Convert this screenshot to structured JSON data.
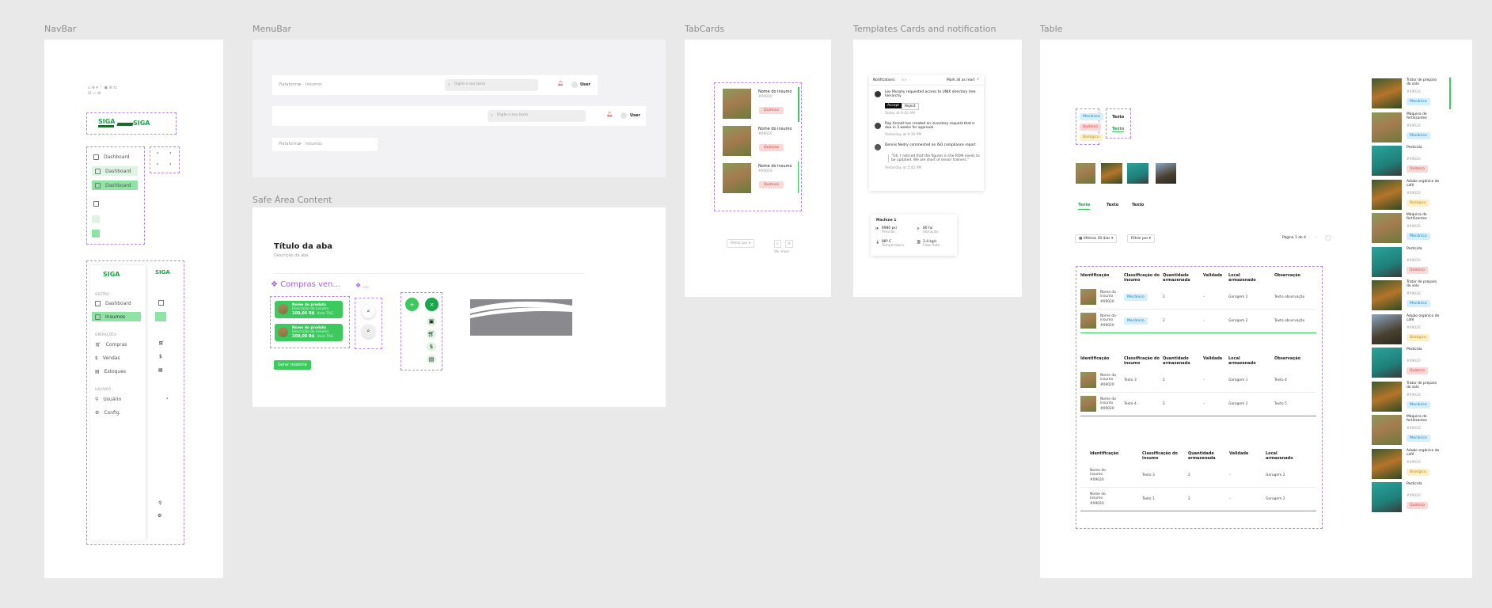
{
  "frames": {
    "navbar": "NavBar",
    "menubar": "MenuBar",
    "tabcards": "TabCards",
    "templates": "Templates Cards and notification",
    "table": "Table",
    "safe_area": "Safe Área Content"
  },
  "navbar": {
    "logo": "SIGA",
    "items": [
      "Dashboard",
      "Dashboard",
      "Dashboard"
    ],
    "sections": {
      "gestao": "GESTÃO",
      "operacoes": "OPERAÇÕES",
      "usuario": "USUÁRIO"
    },
    "menu": {
      "dashboard": "Dashboard",
      "insumos": "Insumos",
      "compras": "Compras",
      "vendas": "Vendas",
      "estoques": "Estoques",
      "usuario": "Usuário",
      "config": "Config."
    }
  },
  "menubar": {
    "breadcrumb_root": "Plataforma",
    "breadcrumb_sep": ">",
    "breadcrumb_current": "Insumos",
    "search_placeholder": "Digite o seu texto",
    "user": "User"
  },
  "safe_area": {
    "title": "Título da aba",
    "description": "Descrição da aba",
    "section_title": "Compras ven...",
    "section_title_2": "...",
    "product_name": "Nome do produto",
    "product_sub": "Descrição do insumo",
    "product_price": "200,00 R$",
    "product_tag": "Item TAG",
    "action_button": "Gerar relatório"
  },
  "tabcards": {
    "cards": [
      {
        "name": "Nome do insumo",
        "code": "#09020",
        "tag": "Químico"
      },
      {
        "name": "Nome do insumo",
        "code": "#09020",
        "tag": "Químico"
      },
      {
        "name": "Nome do insumo",
        "code": "#09020",
        "tag": "Químico"
      }
    ],
    "filter": "Filtrar por",
    "footer": "Ver mais"
  },
  "notifications": {
    "title": "Notifications",
    "mark_all": "Mark all as read",
    "items": [
      {
        "text": "Lex Murphy requested access to UNIX directory tree hierarchy",
        "time": "Today at 9:42 AM",
        "accept": "Accept",
        "reject": "Reject"
      },
      {
        "text": "Ray Arnold has created an inventory request that is due in 3 weeks for approval",
        "time": "Yesterday at 9:30 PM"
      },
      {
        "text": "Dennis Nedry commented on ISO compliance report",
        "quote": "“Oh, I noticed that the figures in the ROM needs to be updated. We are short of senior trainers.”",
        "time": "Yesterday at 5:42 PM"
      }
    ],
    "machine": {
      "title": "Machine 1",
      "stats": [
        {
          "value": "6980 psi",
          "label": "Pressão"
        },
        {
          "value": "80 hz",
          "label": "Vibração"
        },
        {
          "value": "88º C",
          "label": "Temperatura"
        },
        {
          "value": "3.4 kg/s",
          "label": "Flow Rate"
        }
      ]
    }
  },
  "table": {
    "tags": [
      "Mecânico",
      "Químico",
      "Biológico"
    ],
    "tab_texts": [
      "Texto",
      "Texto"
    ],
    "tabs": [
      "Texto",
      "Texto",
      "Texto"
    ],
    "date_filter": "Últimos 30 dias",
    "filter": "Filtrar por",
    "page": "Página 1 de 4",
    "headers": [
      "Identificação",
      "Classificação do insumo",
      "Quantidade armazenada",
      "Validade",
      "Local armazenado",
      "Observação"
    ],
    "block1": [
      {
        "name": "Nome do insumo",
        "code": "#09020",
        "class": "Mecânico",
        "qty": "2",
        "val": "-",
        "local": "Garagem 2",
        "obs": "Texto observação"
      },
      {
        "name": "Nome do insumo",
        "code": "#09020",
        "class": "Mecânico",
        "qty": "2",
        "val": "-",
        "local": "Garagem 2",
        "obs": "Texto observação"
      }
    ],
    "block2": [
      {
        "name": "Nome do insumo",
        "code": "#09020",
        "class": "Texto 3",
        "qty": "2",
        "val": "-",
        "local": "Garagem 1",
        "obs": "Texto 4"
      },
      {
        "name": "Nome do insumo",
        "code": "#09020",
        "class": "Texto 4",
        "qty": "2",
        "val": "-",
        "local": "Garagem 2",
        "obs": "Texto 5"
      }
    ],
    "block3": [
      {
        "name": "Nome do insumo",
        "code": "#09020",
        "class": "Texto 3",
        "qty": "2",
        "val": "-",
        "local": "Garagem 2"
      },
      {
        "name": "Nome do insumo",
        "code": "#09020",
        "class": "Texto 1",
        "qty": "2",
        "val": "-",
        "local": "Garagem 2"
      }
    ],
    "side_list": [
      {
        "name": "Trator de preparo do solo",
        "code": "#09020",
        "tag": "Mecânico"
      },
      {
        "name": "Máquina de fertilizantes",
        "code": "#09020",
        "tag": "Mecânico"
      },
      {
        "name": "Pesticida",
        "code": "#09020",
        "tag": "Químico"
      },
      {
        "name": "Adubo orgânico de café",
        "code": "#09020",
        "tag": "Biológico"
      },
      {
        "name": "Máquina de fertilizantes",
        "code": "#09020",
        "tag": "Mecânico"
      },
      {
        "name": "Pesticida",
        "code": "#09020",
        "tag": "Químico"
      },
      {
        "name": "Trator de preparo do solo",
        "code": "#09020",
        "tag": "Mecânico"
      },
      {
        "name": "Adubo orgânico de café",
        "code": "#09020",
        "tag": "Biológico"
      },
      {
        "name": "Pesticida",
        "code": "#09020",
        "tag": "Químico"
      },
      {
        "name": "Trator de preparo do solo",
        "code": "#09020",
        "tag": "Mecânico"
      },
      {
        "name": "Máquina de fertilizantes",
        "code": "#09020",
        "tag": "Mecânico"
      },
      {
        "name": "Adubo orgânico de café",
        "code": "#09020",
        "tag": "Biológico"
      },
      {
        "name": "Pesticida",
        "code": "#09020",
        "tag": "Químico"
      }
    ]
  },
  "colors": {
    "accent": "#3cc95e",
    "dashed": "#b48cf0",
    "purple": "#a45bf0"
  }
}
